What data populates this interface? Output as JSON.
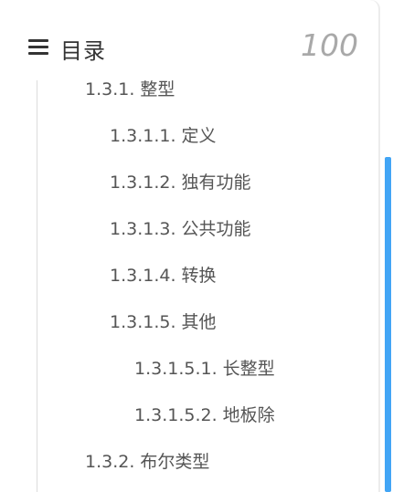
{
  "header": {
    "title": "目录",
    "progress": "100",
    "menu_icon": "hamburger-menu-icon"
  },
  "toc": {
    "items": [
      {
        "label": "1.3.1. 整型",
        "level": 1
      },
      {
        "label": "1.3.1.1. 定义",
        "level": 2
      },
      {
        "label": "1.3.1.2. 独有功能",
        "level": 2
      },
      {
        "label": "1.3.1.3. 公共功能",
        "level": 2
      },
      {
        "label": "1.3.1.4. 转换",
        "level": 2
      },
      {
        "label": "1.3.1.5. 其他",
        "level": 2
      },
      {
        "label": "1.3.1.5.1. 长整型",
        "level": 3
      },
      {
        "label": "1.3.1.5.2. 地板除",
        "level": 3
      },
      {
        "label": "1.3.2. 布尔类型",
        "level": 1
      }
    ]
  },
  "colors": {
    "accent": "#42a5f5",
    "text": "#555555",
    "muted": "#a9a9a9"
  }
}
